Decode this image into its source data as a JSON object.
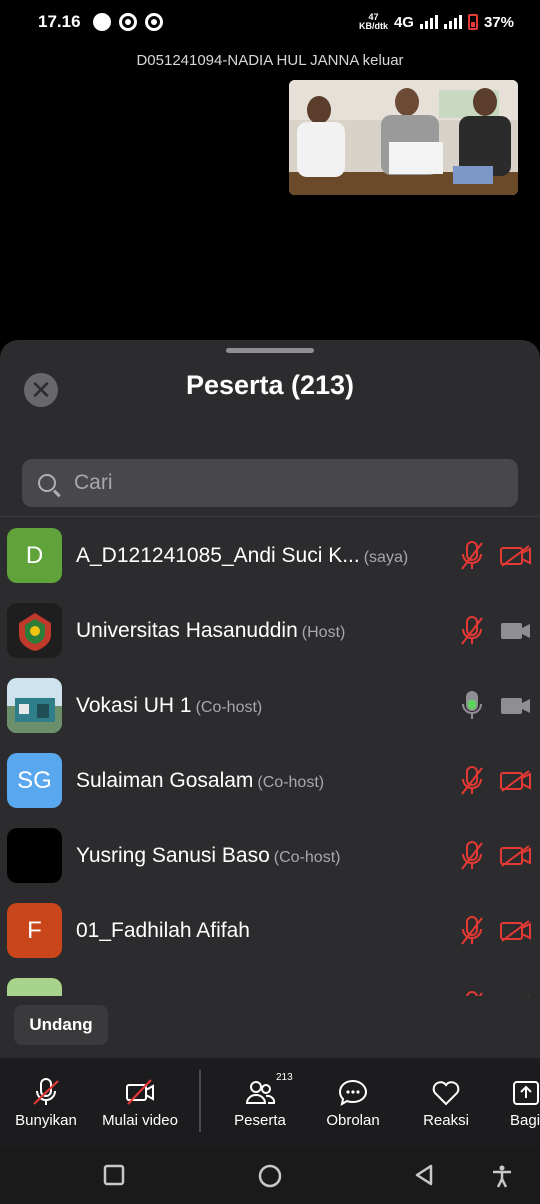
{
  "status": {
    "time": "17.16",
    "net_speed_top": "47",
    "net_speed_bottom": "KB/dtk",
    "network": "4G",
    "battery": "37%"
  },
  "notice": "D051241094-NADIA HUL JANNA keluar",
  "sheet": {
    "title": "Peserta (213)",
    "search_placeholder": "Cari"
  },
  "participants": [
    {
      "initials": "D",
      "name": "A_D121241085_Andi Suci K...",
      "role": "(saya)",
      "avatar_color": "#5fa33a",
      "mic": "muted",
      "cam": "off"
    },
    {
      "initials": "",
      "name": "Universitas Hasanuddin",
      "role": "(Host)",
      "avatar_color": "#1e1e1e",
      "mic": "muted",
      "cam": "available"
    },
    {
      "initials": "",
      "name": "Vokasi UH 1",
      "role": "(Co-host)",
      "avatar_color": "#5a8fa8",
      "mic": "active",
      "cam": "available"
    },
    {
      "initials": "SG",
      "name": "Sulaiman Gosalam",
      "role": "(Co-host)",
      "avatar_color": "#59a7ee",
      "mic": "muted",
      "cam": "off"
    },
    {
      "initials": "",
      "name": "Yusring Sanusi Baso",
      "role": "(Co-host)",
      "avatar_color": "#000000",
      "mic": "muted",
      "cam": "off"
    },
    {
      "initials": "F",
      "name": "01_Fadhilah Afifah",
      "role": "",
      "avatar_color": "#c8461a",
      "mic": "muted",
      "cam": "off"
    },
    {
      "initials": "",
      "name": "",
      "role": "",
      "avatar_color": "#a7d38a",
      "mic": "muted",
      "cam": "off"
    }
  ],
  "invite_label": "Undang",
  "toolbar": {
    "unmute": "Bunyikan",
    "start_video": "Mulai video",
    "participants": "Peserta",
    "participants_count": "213",
    "chat": "Obrolan",
    "reactions": "Reaksi",
    "share": "Bagi"
  },
  "colors": {
    "muted_red": "#e53935",
    "active_green": "#5fd35f",
    "sheet_bg": "#2c2c2e"
  }
}
